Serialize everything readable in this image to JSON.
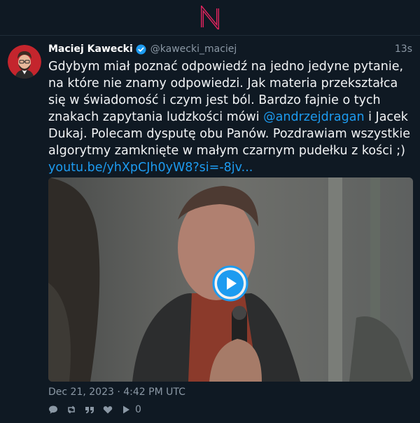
{
  "app": {
    "logo_letter": "N",
    "accent": "#e0245e"
  },
  "post": {
    "author_name": "Maciej Kawecki",
    "handle": "@kawecki_maciej",
    "time_ago": "13s",
    "text_parts": {
      "p1": "Gdybym miał poznać odpowiedź na jedno jedyne pytanie, na które nie znamy odpowiedzi. Jak materia przekształca się w świadomość i czym jest ból. Bardzo fajnie o tych znakach zapytania ludzkości mówi ",
      "mention": "@andrzejdragan",
      "p2": " i Jacek Dukaj. Polecam dysputę obu Panów. Pozdrawiam wszystkie algorytmy zamknięte w małym czarnym pudełku z kości ;)",
      "link": "youtu.be/yhXpCJh0yW8?si=-8jv..."
    },
    "date": "Dec 21, 2023 · 4:42 PM UTC",
    "zap_count": "0"
  },
  "icons": {
    "verified": "verified-badge-icon",
    "reply": "reply-icon",
    "repost": "repost-icon",
    "quote": "quote-icon",
    "like": "heart-icon",
    "zap": "play-zap-icon",
    "play": "play-icon"
  },
  "colors": {
    "link": "#1d9bf0",
    "muted": "#8b98a5",
    "background": "#0f1923"
  }
}
